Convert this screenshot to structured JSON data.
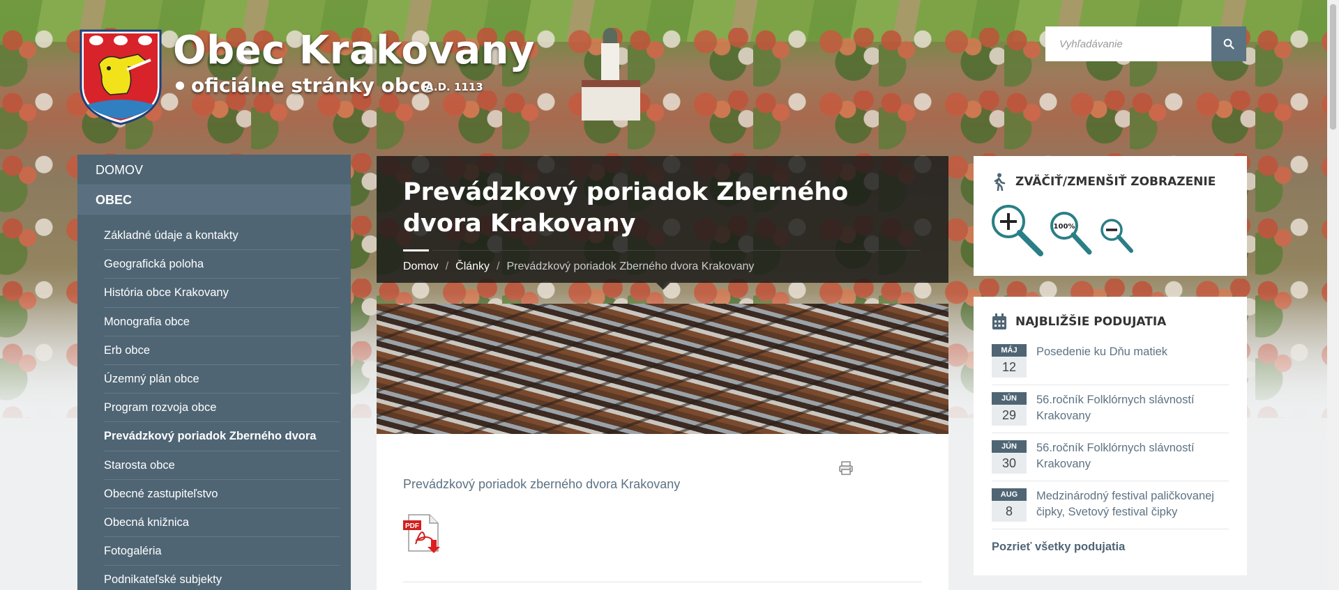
{
  "site": {
    "title": "Obec Krakovany",
    "subtitle": "oficiálne stránky obce",
    "year": "A.D. 1113"
  },
  "search": {
    "placeholder": "Vyhľadávanie"
  },
  "sidebar": {
    "items": [
      {
        "label": "DOMOV"
      },
      {
        "label": "OBEC"
      }
    ],
    "subitems": [
      {
        "label": "Základné údaje a kontakty"
      },
      {
        "label": "Geografická poloha"
      },
      {
        "label": "História obce Krakovany"
      },
      {
        "label": "Monografia obce"
      },
      {
        "label": "Erb obce"
      },
      {
        "label": "Územný plán obce"
      },
      {
        "label": "Program rozvoja obce"
      },
      {
        "label": "Prevádzkový poriadok Zberného dvora"
      },
      {
        "label": "Starosta obce"
      },
      {
        "label": "Obecné zastupiteľstvo"
      },
      {
        "label": "Obecná knižnica"
      },
      {
        "label": "Fotogaléria"
      },
      {
        "label": "Podnikateľské subjekty"
      }
    ]
  },
  "main": {
    "title": "Prevádzkový poriadok Zberného dvora Krakovany",
    "breadcrumb": {
      "home": "Domov",
      "section": "Články",
      "current": "Prevádzkový poriadok Zberného dvora Krakovany",
      "separator": "/"
    },
    "document_link": "Prevádzkový poriadok zberného dvora Krakovany",
    "pdf_label": "PDF"
  },
  "zoom": {
    "title": "ZVÄČIŤ/ZMENŠIŤ ZOBRAZENIE",
    "reset_label": "100%"
  },
  "events": {
    "title": "NAJBLIŽŠIE PODUJATIA",
    "items": [
      {
        "month": "MÁJ",
        "day": "12",
        "title": "Posedenie ku Dňu matiek"
      },
      {
        "month": "JÚN",
        "day": "29",
        "title": "56.ročník Folklórnych slávností Krakovany"
      },
      {
        "month": "JÚN",
        "day": "30",
        "title": "56.ročník Folklórnych slávností Krakovany"
      },
      {
        "month": "AUG",
        "day": "8",
        "title": "Medzinárodný festival paličkovanej čipky, Svetový festival čipky"
      }
    ],
    "all_label": "Pozrieť všetky podujatia"
  },
  "colors": {
    "sidebar": "#4f6574",
    "accent": "#5d7283",
    "zoom_teal": "#2a7f86"
  }
}
